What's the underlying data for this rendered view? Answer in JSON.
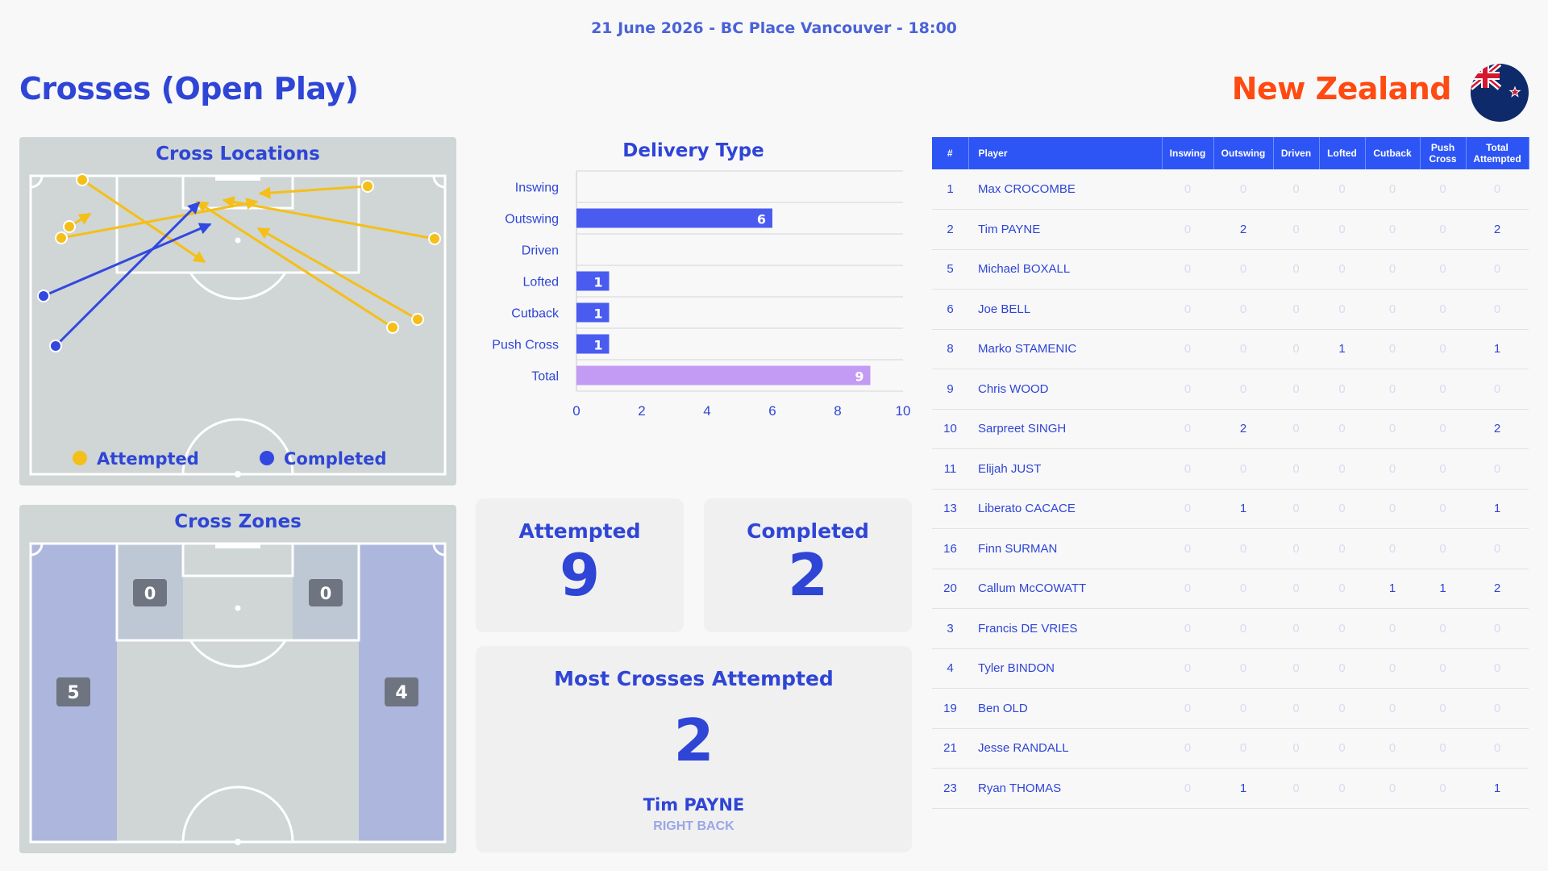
{
  "header": {
    "match_info": "21 June 2026 - BC Place Vancouver - 18:00",
    "title": "Crosses (Open Play)",
    "team": "New Zealand"
  },
  "colors": {
    "accent": "#2f45d6",
    "team": "#ff4a12",
    "attempted": "#f5bf19",
    "completed": "#3348e0",
    "bar": "#4a5cf0",
    "total_bar": "#c39bf5",
    "table_header": "#2d55f5"
  },
  "flag_icon": "new-zealand-flag-icon",
  "cross_locations": {
    "title": "Cross Locations",
    "legend": [
      {
        "label": "Attempted",
        "color": "#f5bf19"
      },
      {
        "label": "Completed",
        "color": "#3348e0"
      }
    ]
  },
  "cross_zones": {
    "title": "Cross Zones",
    "zones": {
      "left_wide": "5",
      "right_wide": "4",
      "left_box": "0",
      "right_box": "0"
    }
  },
  "summary": {
    "attempted_label": "Attempted",
    "attempted_value": "9",
    "completed_label": "Completed",
    "completed_value": "2",
    "most_label": "Most Crosses Attempted",
    "most_value": "2",
    "most_player": "Tim PAYNE",
    "most_position": "RIGHT BACK"
  },
  "chart_data": {
    "type": "bar",
    "orientation": "horizontal",
    "title": "Delivery Type",
    "categories": [
      "Inswing",
      "Outswing",
      "Driven",
      "Lofted",
      "Cutback",
      "Push Cross",
      "Total"
    ],
    "values": [
      0,
      6,
      0,
      1,
      1,
      1,
      9
    ],
    "xlim": [
      0,
      10
    ],
    "xticks": [
      0,
      2,
      4,
      6,
      8,
      10
    ],
    "grid": true
  },
  "table": {
    "headers": [
      "#",
      "Player",
      "Inswing",
      "Outswing",
      "Driven",
      "Lofted",
      "Cutback",
      "Push Cross",
      "Total Attempted"
    ],
    "rows": [
      [
        "1",
        "Max CROCOMBE",
        "0",
        "0",
        "0",
        "0",
        "0",
        "0",
        "0"
      ],
      [
        "2",
        "Tim PAYNE",
        "0",
        "2",
        "0",
        "0",
        "0",
        "0",
        "2"
      ],
      [
        "5",
        "Michael BOXALL",
        "0",
        "0",
        "0",
        "0",
        "0",
        "0",
        "0"
      ],
      [
        "6",
        "Joe BELL",
        "0",
        "0",
        "0",
        "0",
        "0",
        "0",
        "0"
      ],
      [
        "8",
        "Marko STAMENIC",
        "0",
        "0",
        "0",
        "1",
        "0",
        "0",
        "1"
      ],
      [
        "9",
        "Chris WOOD",
        "0",
        "0",
        "0",
        "0",
        "0",
        "0",
        "0"
      ],
      [
        "10",
        "Sarpreet SINGH",
        "0",
        "2",
        "0",
        "0",
        "0",
        "0",
        "2"
      ],
      [
        "11",
        "Elijah JUST",
        "0",
        "0",
        "0",
        "0",
        "0",
        "0",
        "0"
      ],
      [
        "13",
        "Liberato CACACE",
        "0",
        "1",
        "0",
        "0",
        "0",
        "0",
        "1"
      ],
      [
        "16",
        "Finn SURMAN",
        "0",
        "0",
        "0",
        "0",
        "0",
        "0",
        "0"
      ],
      [
        "20",
        "Callum McCOWATT",
        "0",
        "0",
        "0",
        "0",
        "1",
        "1",
        "2"
      ],
      [
        "3",
        "Francis DE VRIES",
        "0",
        "0",
        "0",
        "0",
        "0",
        "0",
        "0"
      ],
      [
        "4",
        "Tyler BINDON",
        "0",
        "0",
        "0",
        "0",
        "0",
        "0",
        "0"
      ],
      [
        "19",
        "Ben OLD",
        "0",
        "0",
        "0",
        "0",
        "0",
        "0",
        "0"
      ],
      [
        "21",
        "Jesse RANDALL",
        "0",
        "0",
        "0",
        "0",
        "0",
        "0",
        "0"
      ],
      [
        "23",
        "Ryan THOMAS",
        "0",
        "1",
        "0",
        "0",
        "0",
        "0",
        "1"
      ]
    ]
  }
}
